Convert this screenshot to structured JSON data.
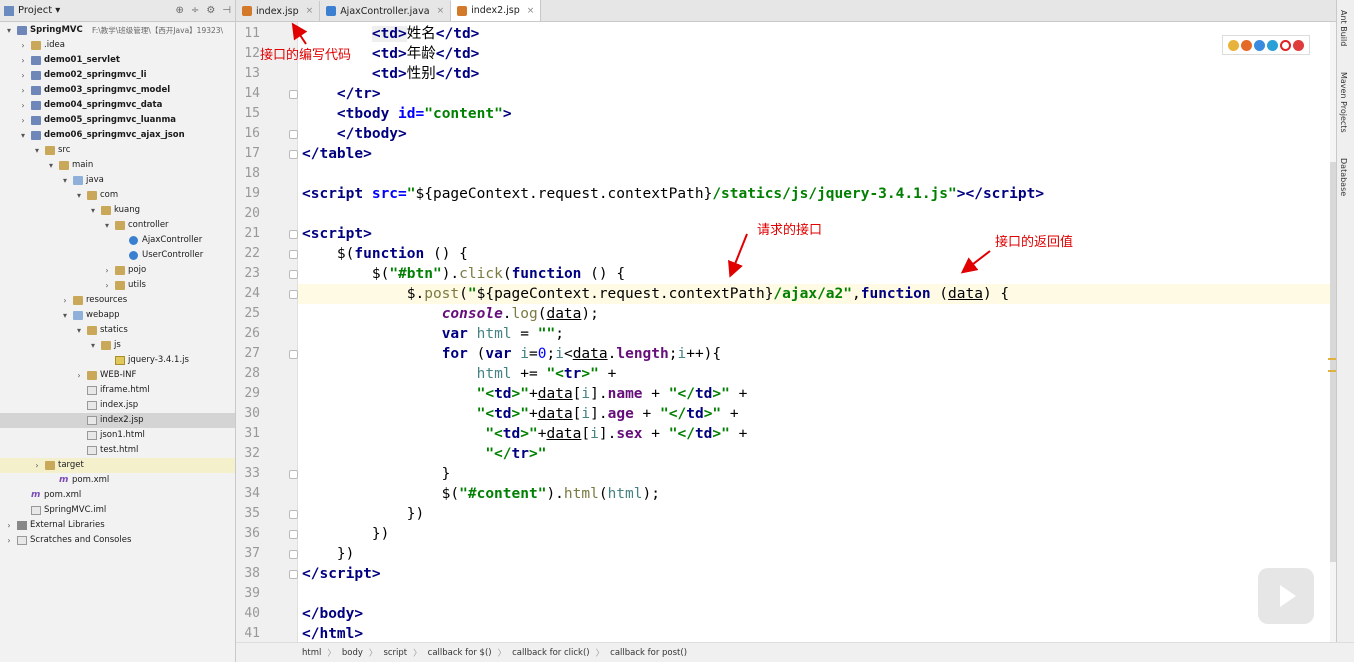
{
  "project_header": {
    "label": "Project",
    "dropdown": "▾"
  },
  "tree": [
    {
      "label": "SpringMVC",
      "suffix": "F:\\教学\\班级管理\\【西开Java】19323\\",
      "bold": true,
      "icon": "module",
      "arrow": "▾",
      "depth": 0
    },
    {
      "label": ".idea",
      "icon": "folder",
      "arrow": "›",
      "depth": 1
    },
    {
      "label": "demo01_servlet",
      "bold": true,
      "icon": "module",
      "arrow": "›",
      "depth": 1
    },
    {
      "label": "demo02_springmvc_li",
      "bold": true,
      "icon": "module",
      "arrow": "›",
      "depth": 1
    },
    {
      "label": "demo03_springmvc_model",
      "bold": true,
      "icon": "module",
      "arrow": "›",
      "depth": 1
    },
    {
      "label": "demo04_springmvc_data",
      "bold": true,
      "icon": "module",
      "arrow": "›",
      "depth": 1
    },
    {
      "label": "demo05_springmvc_luanma",
      "bold": true,
      "icon": "module",
      "arrow": "›",
      "depth": 1
    },
    {
      "label": "demo06_springmvc_ajax_json",
      "bold": true,
      "icon": "module",
      "arrow": "▾",
      "depth": 1
    },
    {
      "label": "src",
      "icon": "folder",
      "arrow": "▾",
      "depth": 2
    },
    {
      "label": "main",
      "icon": "folder",
      "arrow": "▾",
      "depth": 3
    },
    {
      "label": "java",
      "icon": "folder-blue",
      "arrow": "▾",
      "depth": 4
    },
    {
      "label": "com",
      "icon": "folder",
      "arrow": "▾",
      "depth": 5
    },
    {
      "label": "kuang",
      "icon": "folder",
      "arrow": "▾",
      "depth": 6
    },
    {
      "label": "controller",
      "icon": "folder",
      "arrow": "▾",
      "depth": 7
    },
    {
      "label": "AjaxController",
      "icon": "class",
      "arrow": "",
      "depth": 8
    },
    {
      "label": "UserController",
      "icon": "class",
      "arrow": "",
      "depth": 8
    },
    {
      "label": "pojo",
      "icon": "folder",
      "arrow": "›",
      "depth": 7
    },
    {
      "label": "utils",
      "icon": "folder",
      "arrow": "›",
      "depth": 7
    },
    {
      "label": "resources",
      "icon": "folder",
      "arrow": "›",
      "depth": 4
    },
    {
      "label": "webapp",
      "icon": "folder-blue",
      "arrow": "▾",
      "depth": 4
    },
    {
      "label": "statics",
      "icon": "folder",
      "arrow": "▾",
      "depth": 5
    },
    {
      "label": "js",
      "icon": "folder",
      "arrow": "▾",
      "depth": 6
    },
    {
      "label": "jquery-3.4.1.js",
      "icon": "js",
      "arrow": "",
      "depth": 7
    },
    {
      "label": "WEB-INF",
      "icon": "folder",
      "arrow": "›",
      "depth": 5
    },
    {
      "label": "iframe.html",
      "icon": "file",
      "arrow": "",
      "depth": 5
    },
    {
      "label": "index.jsp",
      "icon": "file",
      "arrow": "",
      "depth": 5
    },
    {
      "label": "index2.jsp",
      "icon": "file",
      "arrow": "",
      "depth": 5,
      "selected": true
    },
    {
      "label": "json1.html",
      "icon": "file",
      "arrow": "",
      "depth": 5
    },
    {
      "label": "test.html",
      "icon": "file",
      "arrow": "",
      "depth": 5
    },
    {
      "label": "target",
      "icon": "folder",
      "arrow": "›",
      "depth": 2,
      "highlight": true
    },
    {
      "label": "pom.xml",
      "icon": "m",
      "arrow": "",
      "depth": 3
    },
    {
      "label": "pom.xml",
      "icon": "m",
      "arrow": "",
      "depth": 1
    },
    {
      "label": "SpringMVC.iml",
      "icon": "file",
      "arrow": "",
      "depth": 1
    },
    {
      "label": "External Libraries",
      "icon": "lib",
      "arrow": "›",
      "depth": 0
    },
    {
      "label": "Scratches and Consoles",
      "icon": "file",
      "arrow": "›",
      "depth": 0
    }
  ],
  "tabs": [
    {
      "label": "index.jsp",
      "color": "#d27a2a",
      "active": false
    },
    {
      "label": "AjaxController.java",
      "color": "#3a7fd0",
      "active": false
    },
    {
      "label": "index2.jsp",
      "color": "#d27a2a",
      "active": true
    }
  ],
  "line_numbers": [
    "11",
    "12",
    "13",
    "14",
    "15",
    "16",
    "17",
    "18",
    "19",
    "20",
    "21",
    "22",
    "23",
    "24",
    "25",
    "26",
    "27",
    "28",
    "29",
    "30",
    "31",
    "32",
    "33",
    "34",
    "35",
    "36",
    "37",
    "38",
    "39",
    "40",
    "41"
  ],
  "breadcrumb": [
    "html",
    "body",
    "script",
    "callback for $()",
    "callback for click()",
    "callback for post()"
  ],
  "breadcrumb_sep": "〉",
  "annotations": {
    "code_note": "接口的编写代码",
    "request_note": "请求的接口",
    "return_note": "接口的返回值"
  },
  "right_panel": {
    "ant": "Ant Build",
    "maven": "Maven Projects",
    "database": "Database"
  },
  "colors": {
    "annotation": "#e00000",
    "keyword": "#000080",
    "string": "#008000",
    "current_line": "#fffae3"
  }
}
